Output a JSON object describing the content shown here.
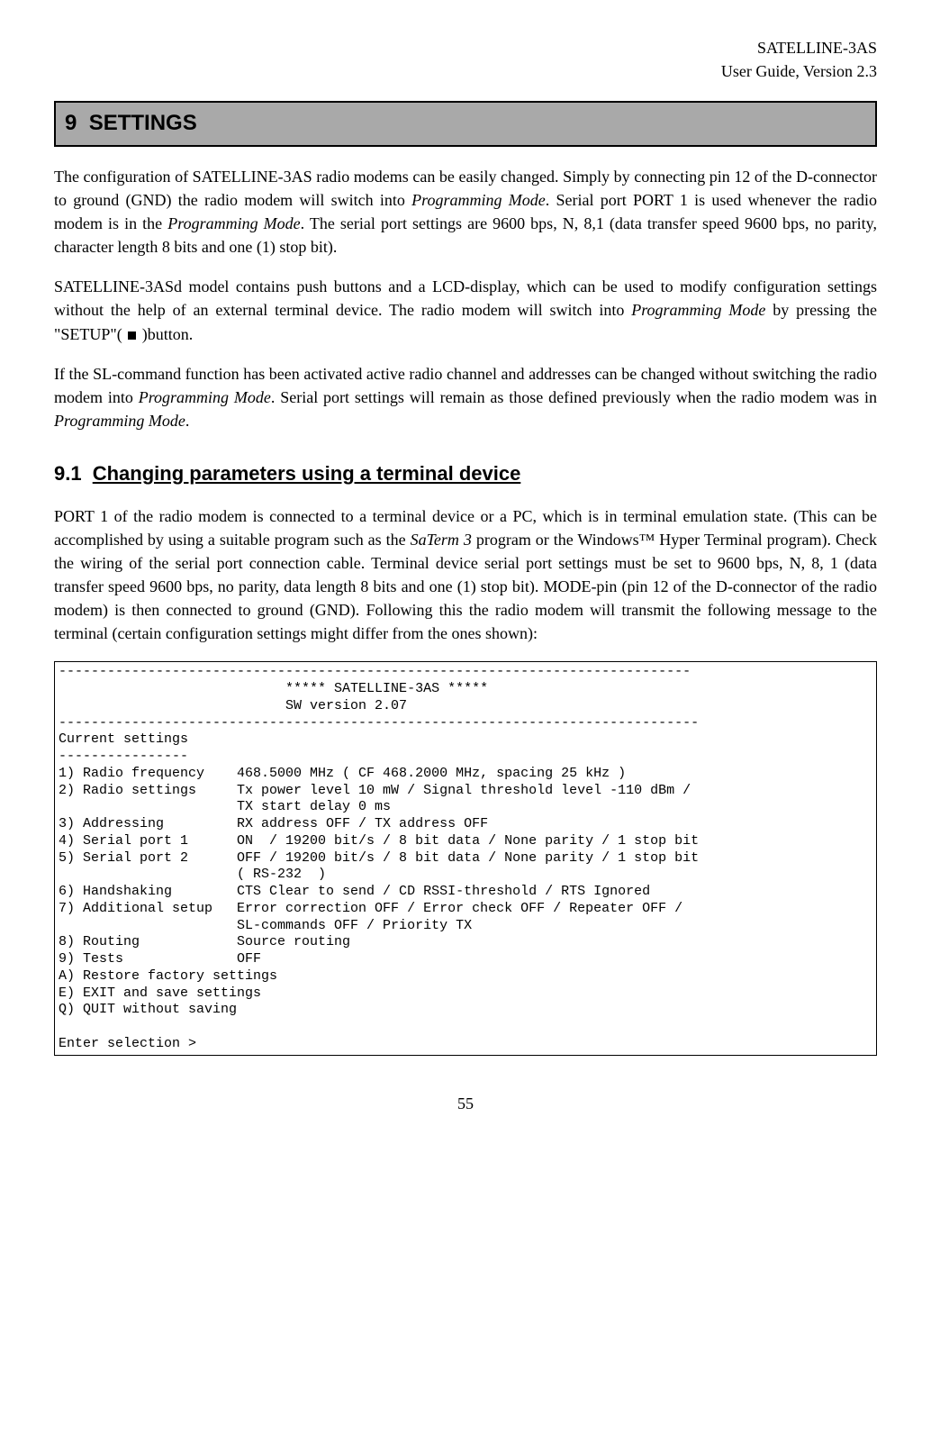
{
  "header": {
    "product": "SATELLINE-3AS",
    "guide": "User Guide, Version 2.3"
  },
  "section": {
    "number": "9",
    "title": "SETTINGS"
  },
  "paragraphs": {
    "p1a": "The configuration of SATELLINE-3AS radio modems can be easily changed. Simply by connecting pin 12 of the D-connector to ground (GND) the radio modem will switch into ",
    "p1b": "Programming Mode",
    "p1c": ". Serial port PORT 1 is used whenever the radio modem is in the ",
    "p1d": "Programming Mode",
    "p1e": ". The serial port settings are 9600 bps, N, 8,1 (data transfer speed 9600 bps, no parity, character length 8 bits and one (1) stop bit).",
    "p2a": "SATELLINE-3ASd model contains push buttons and a LCD-display, which can be used to modify configuration settings without the help of an external terminal device. The radio modem will switch into ",
    "p2b": "Programming Mode",
    "p2c": " by pressing the \"SETUP\"( ",
    "p2d": " )button.",
    "p3a": "If the SL-command function has been activated active radio channel and addresses can be changed without switching the radio modem into ",
    "p3b": "Programming Mode",
    "p3c": ". Serial port settings will remain as those defined previously when the radio modem was in ",
    "p3d": "Programming Mode",
    "p3e": "."
  },
  "subsection": {
    "number": "9.1",
    "title": "Changing parameters using a terminal device"
  },
  "subparagraph": {
    "s1a": "PORT 1 of the radio modem is connected to a terminal device or a PC, which is in terminal emulation state. (This can be accomplished by using a suitable program such as the ",
    "s1b": "SaTerm 3",
    "s1c": " program or the Windows™ Hyper Terminal program). Check the wiring of the serial port connection cable. Terminal device serial port settings must be set to 9600 bps, N, 8, 1 (data transfer speed 9600 bps, no parity, data length 8 bits and one (1) stop bit). MODE-pin (pin 12 of the D-connector of the radio modem) is then connected to ground (GND). Following this the radio modem will transmit the following message to the terminal (certain configuration settings might differ from the ones shown):"
  },
  "terminal": "------------------------------------------------------------------------------\n                            ***** SATELLINE-3AS *****\n                            SW version 2.07\n-------------------------------------------------------------------------------\nCurrent settings\n----------------\n1) Radio frequency    468.5000 MHz ( CF 468.2000 MHz, spacing 25 kHz )\n2) Radio settings     Tx power level 10 mW / Signal threshold level -110 dBm /\n                      TX start delay 0 ms\n3) Addressing         RX address OFF / TX address OFF\n4) Serial port 1      ON  / 19200 bit/s / 8 bit data / None parity / 1 stop bit\n5) Serial port 2      OFF / 19200 bit/s / 8 bit data / None parity / 1 stop bit\n                      ( RS-232  )\n6) Handshaking        CTS Clear to send / CD RSSI-threshold / RTS Ignored\n7) Additional setup   Error correction OFF / Error check OFF / Repeater OFF /\n                      SL-commands OFF / Priority TX\n8) Routing            Source routing\n9) Tests              OFF\nA) Restore factory settings\nE) EXIT and save settings\nQ) QUIT without saving\n\nEnter selection >",
  "page_number": "55"
}
